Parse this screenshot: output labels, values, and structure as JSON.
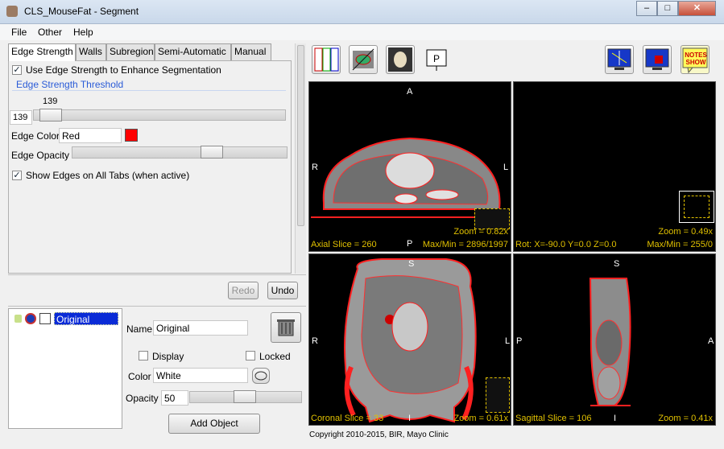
{
  "window": {
    "title": "CLS_MouseFat - Segment",
    "min": "–",
    "max": "□",
    "close": "✕"
  },
  "menu": [
    "File",
    "Other",
    "Help"
  ],
  "tabs": [
    "Edge Strength",
    "Walls",
    "Subregion",
    "Semi-Automatic",
    "Manual"
  ],
  "edge": {
    "use_label": "Use Edge Strength to Enhance Segmentation",
    "threshold_title": "Edge Strength Threshold",
    "threshold_value": "139",
    "threshold_field": "139",
    "color_label": "Edge Color",
    "color_value": "Red",
    "color_swatch": "#ff0000",
    "opacity_label": "Edge Opacity",
    "show_label": "Show Edges on All Tabs (when active)"
  },
  "history": {
    "redo": "Redo",
    "undo": "Undo"
  },
  "objects": {
    "item": "Original"
  },
  "properties": {
    "name_label": "Name",
    "name_value": "Original",
    "display_label": "Display",
    "locked_label": "Locked",
    "color_label": "Color",
    "color_value": "White",
    "opacity_label": "Opacity",
    "opacity_value": "50",
    "add_button": "Add Object"
  },
  "viewer": {
    "axial": {
      "top": "A",
      "left": "R",
      "right": "L",
      "bottom": "P",
      "zoom": "Zoom = 0.82x",
      "slice": "Axial Slice = 260",
      "maxmin": "Max/Min = 2896/1997"
    },
    "render": {
      "zoom": "Zoom = 0.49x",
      "rot": "Rot: X=-90.0 Y=0.0 Z=0.0",
      "maxmin": "Max/Min = 255/0"
    },
    "coronal": {
      "top": "S",
      "left": "R",
      "right": "L",
      "bottom": "I",
      "zoom": "Zoom = 0.61x",
      "slice": "Coronal Slice = 33"
    },
    "sagittal": {
      "top": "S",
      "left": "P",
      "right": "A",
      "bottom": "I",
      "zoom": "Zoom = 0.41x",
      "slice": "Sagittal Slice = 106"
    }
  },
  "notes_text": "NOTES SHOW",
  "copyright": "Copyright 2010-2015, BIR, Mayo Clinic"
}
